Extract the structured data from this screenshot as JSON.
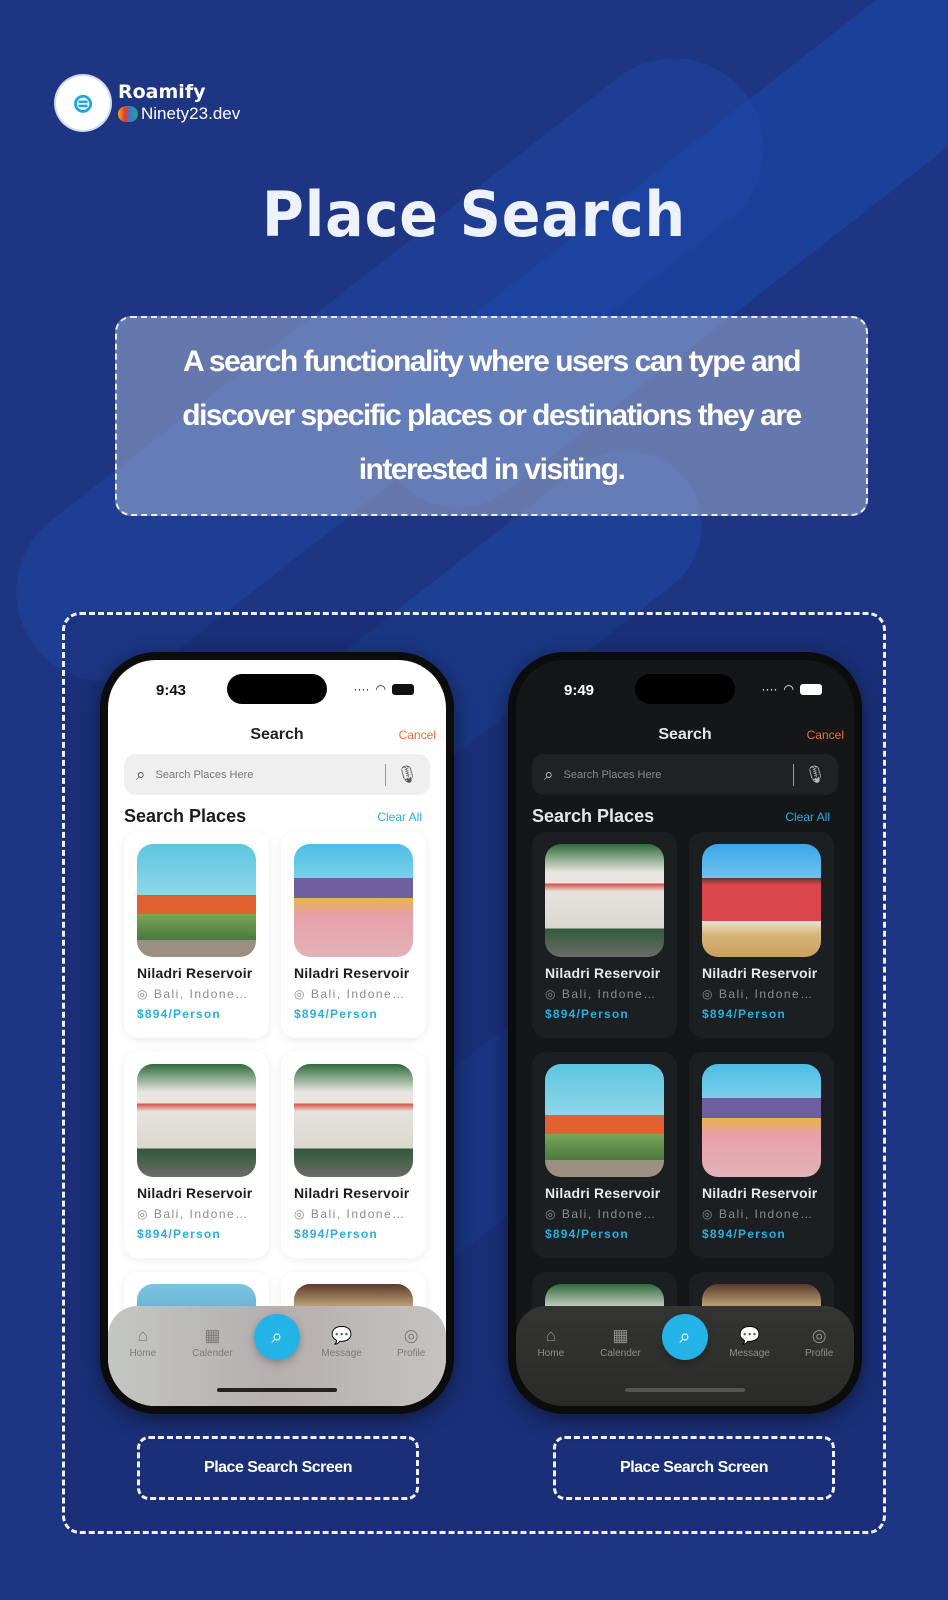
{
  "brand": {
    "name": "Roamify",
    "sub": "Ninety23.dev",
    "logo_icon": "globe-icon"
  },
  "title": "Place Search",
  "description": "A search functionality where users can type and discover specific places or destinations they are interested in visiting.",
  "colors": {
    "background": "#1d3583",
    "accent": "#23b3e6",
    "cancel": "#f46a2e"
  },
  "phones": [
    {
      "theme": "light",
      "time": "9:43",
      "header": "Search",
      "cancel": "Cancel",
      "search_placeholder": "Search Places Here",
      "section": "Search Places",
      "clear": "Clear All",
      "cards": [
        {
          "name": "Niladri Reservoir",
          "location": "Bali, Indone…",
          "price": "$894/Person",
          "scene": "modern-house"
        },
        {
          "name": "Niladri Reservoir",
          "location": "Bali, Indone…",
          "price": "$894/Person",
          "scene": "desert-house"
        },
        {
          "name": "Niladri Reservoir",
          "location": "Bali, Indone…",
          "price": "$894/Person",
          "scene": "white-villa"
        },
        {
          "name": "Niladri Reservoir",
          "location": "Bali, Indone…",
          "price": "$894/Person",
          "scene": "white-villa"
        },
        {
          "name": "",
          "location": "",
          "price": "",
          "scene": "mountain"
        },
        {
          "name": "",
          "location": "",
          "price": "",
          "scene": "forest"
        }
      ],
      "tabs": [
        "Home",
        "Calender",
        "Message",
        "Profile"
      ]
    },
    {
      "theme": "dark",
      "time": "9:49",
      "header": "Search",
      "cancel": "Cancel",
      "search_placeholder": "Search Places Here",
      "section": "Search Places",
      "clear": "Clear All",
      "cards": [
        {
          "name": "Niladri Reservoir",
          "location": "Bali, Indone…",
          "price": "$894/Person",
          "scene": "white-villa"
        },
        {
          "name": "Niladri Reservoir",
          "location": "Bali, Indone…",
          "price": "$894/Person",
          "scene": "red-house"
        },
        {
          "name": "Niladri Reservoir",
          "location": "Bali, Indone…",
          "price": "$894/Person",
          "scene": "modern-house"
        },
        {
          "name": "Niladri Reservoir",
          "location": "Bali, Indone…",
          "price": "$894/Person",
          "scene": "desert-house"
        },
        {
          "name": "",
          "location": "",
          "price": "",
          "scene": "white-villa"
        },
        {
          "name": "",
          "location": "",
          "price": "",
          "scene": "forest"
        }
      ],
      "tabs": [
        "Home",
        "Calender",
        "Message",
        "Profile"
      ]
    }
  ],
  "captions": [
    "Place Search Screen",
    "Place Search Screen"
  ]
}
